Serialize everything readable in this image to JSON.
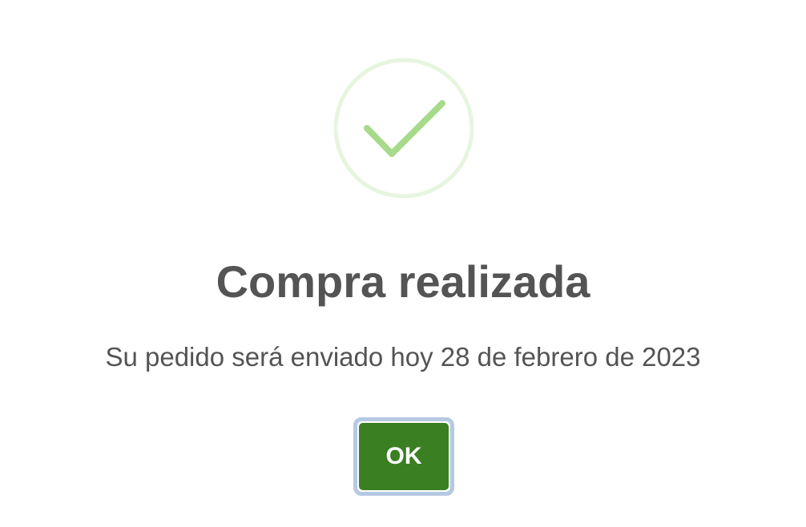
{
  "dialog": {
    "icon": "check-icon",
    "colors": {
      "icon_ring": "#e7f5df",
      "icon_check": "#a7da8a",
      "title_text": "#545454",
      "button_bg": "#3a7f22",
      "button_focus_ring": "#b6c9e3"
    },
    "title": "Compra realizada",
    "message": "Su pedido será enviado hoy 28 de febrero de 2023",
    "confirm_label": "OK"
  }
}
